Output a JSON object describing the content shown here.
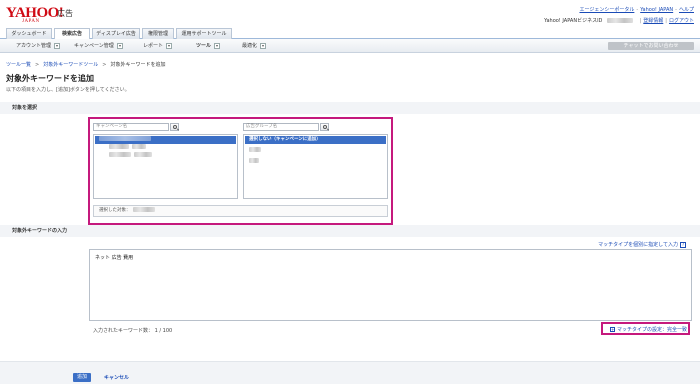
{
  "header": {
    "logo_main": "YAHOO!",
    "logo_sub": "JAPAN",
    "logo_label": "広告",
    "links_row1": [
      "エージェンシーポータル",
      "Yahoo! JAPAN",
      "ヘルプ"
    ],
    "account_label": "Yahoo! JAPANビジネスID",
    "account_links": [
      "登録情報",
      "ログアウト"
    ]
  },
  "tabs": [
    {
      "label": "ダッシュボード",
      "active": false
    },
    {
      "label": "検索広告",
      "active": true
    },
    {
      "label": "ディスプレイ広告",
      "active": false
    },
    {
      "label": "権限管理",
      "active": false
    },
    {
      "label": "運用サポートツール",
      "active": false
    }
  ],
  "subnav": [
    {
      "label": "アカウント管理",
      "dropdown": true
    },
    {
      "label": "キャンペーン管理",
      "dropdown": true
    },
    {
      "label": "レポート",
      "dropdown": true
    },
    {
      "label": "ツール",
      "dropdown": true,
      "active": true
    },
    {
      "label": "最適化",
      "dropdown": true
    }
  ],
  "chat_button": "チャットでお問い合わせ",
  "breadcrumb": [
    "ツール一覧",
    "対象外キーワードツール",
    "対象外キーワードを追加"
  ],
  "page": {
    "title": "対象外キーワードを追加",
    "description": "以下の項目を入力し、[追加]ボタンを押してください。"
  },
  "target_section": {
    "heading": "対象を選択",
    "campaign_placeholder": "キャンペーン名",
    "adgroup_placeholder": "広告グループ名",
    "adgroup_selected": "選択しない（キャンペーンに追加）",
    "selected_label": "選択した対象："
  },
  "keyword_section": {
    "heading": "対象外キーワードの入力",
    "match_type_link": "マッチタイプを個別に指定して入力",
    "help": "?",
    "keywords_text": "ネット 広告 費用",
    "count_text": "入力されたキーワード数： 1 / 100",
    "match_setting": "マッチタイプの設定：完全一致",
    "plus": "+"
  },
  "footer": {
    "add_label": "追加",
    "cancel_label": "キャンセル"
  },
  "colors": {
    "brand_red": "#d00a14",
    "link_blue": "#1a4bb6",
    "selection_blue": "#3b6fc6",
    "highlight_magenta": "#c5197d"
  }
}
